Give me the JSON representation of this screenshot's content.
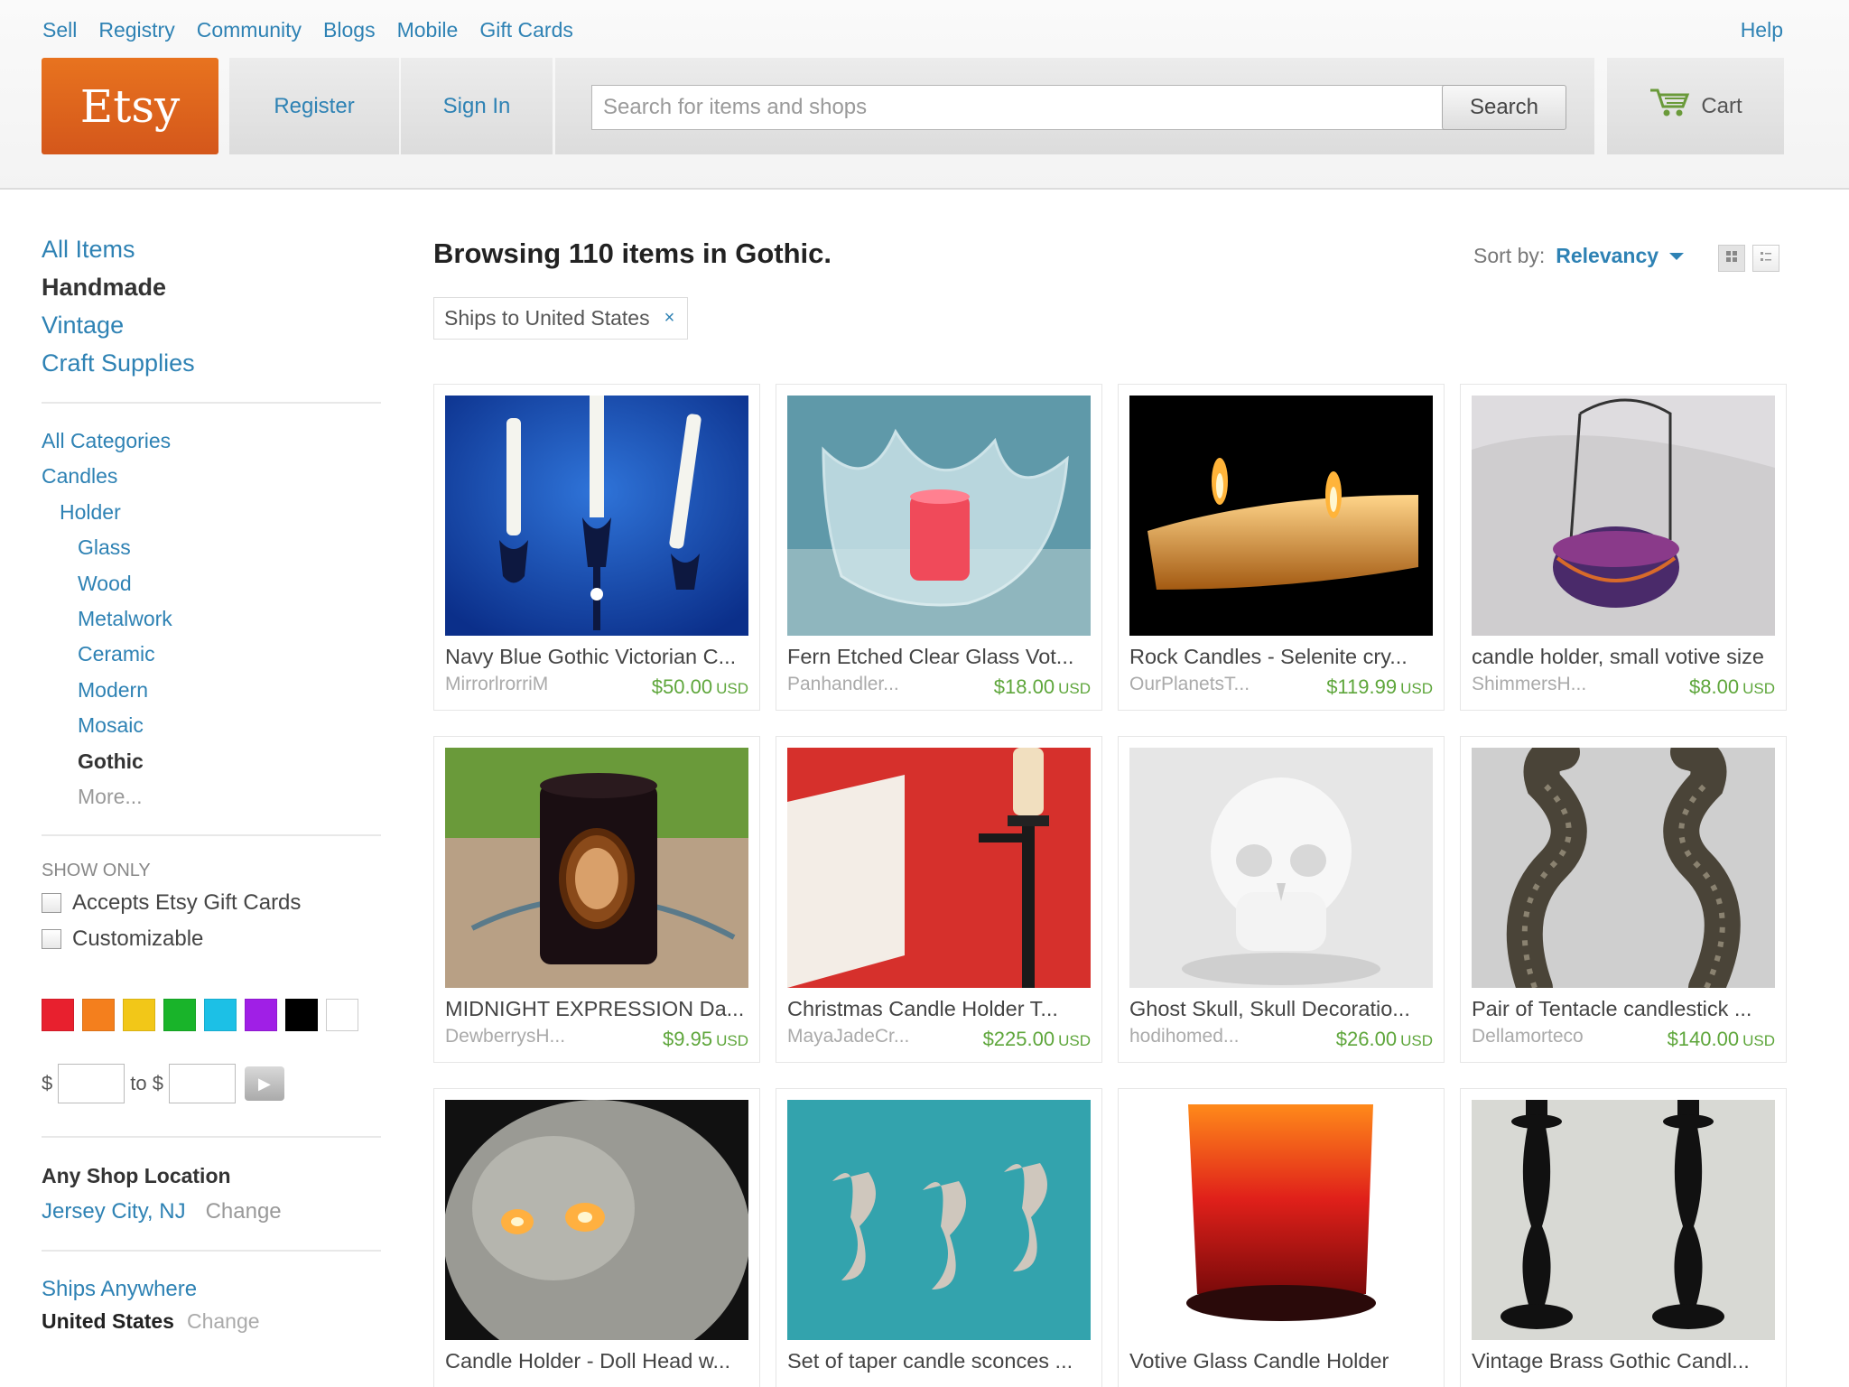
{
  "header": {
    "topnav": [
      "Sell",
      "Registry",
      "Community",
      "Blogs",
      "Mobile",
      "Gift Cards"
    ],
    "help": "Help",
    "logo": "Etsy",
    "register": "Register",
    "signin": "Sign In",
    "search_placeholder": "Search for items and shops",
    "search_button": "Search",
    "cart": "Cart"
  },
  "sidebar": {
    "main_links": [
      {
        "label": "All Items",
        "active": false
      },
      {
        "label": "Handmade",
        "active": true
      },
      {
        "label": "Vintage",
        "active": false
      },
      {
        "label": "Craft Supplies",
        "active": false
      }
    ],
    "categories": [
      {
        "label": "All Categories",
        "level": 0
      },
      {
        "label": "Candles",
        "level": 0
      },
      {
        "label": "Holder",
        "level": 1
      },
      {
        "label": "Glass",
        "level": 2
      },
      {
        "label": "Wood",
        "level": 2
      },
      {
        "label": "Metalwork",
        "level": 2
      },
      {
        "label": "Ceramic",
        "level": 2
      },
      {
        "label": "Modern",
        "level": 2
      },
      {
        "label": "Mosaic",
        "level": 2
      },
      {
        "label": "Gothic",
        "level": 2,
        "active": true
      },
      {
        "label": "More...",
        "level": 2,
        "more": true
      }
    ],
    "show_only_title": "SHOW ONLY",
    "checkboxes": [
      "Accepts Etsy Gift Cards",
      "Customizable"
    ],
    "swatches": [
      "#e8202e",
      "#f47f1d",
      "#f2c718",
      "#19b42a",
      "#1cc0e6",
      "#a01fe6",
      "#000000",
      "#ffffff"
    ],
    "price": {
      "dollar": "$",
      "to": "to $"
    },
    "location_title": "Any Shop Location",
    "location_city": "Jersey City, NJ",
    "change": "Change",
    "ships_anywhere": "Ships Anywhere",
    "ships_country": "United States"
  },
  "main": {
    "browse_title": "Browsing 110 items in Gothic.",
    "sort_label": "Sort by:",
    "sort_value": "Relevancy",
    "filter_chip": "Ships to United States",
    "filter_remove": "×",
    "currency": "USD",
    "items": [
      {
        "title": "Navy Blue Gothic Victorian C...",
        "shop": "MirrorlrorriM",
        "price": "$50.00",
        "image": "blue-candles"
      },
      {
        "title": "Fern Etched Clear Glass Vot...",
        "shop": "Panhandler...",
        "price": "$18.00",
        "image": "glass-votive"
      },
      {
        "title": "Rock Candles - Selenite cry...",
        "shop": "OurPlanetsT...",
        "price": "$119.99",
        "image": "rock-candle"
      },
      {
        "title": "candle holder, small votive size",
        "shop": "ShimmersH...",
        "price": "$8.00",
        "image": "basket-holder"
      },
      {
        "title": "MIDNIGHT EXPRESSION Da...",
        "shop": "DewberrysH...",
        "price": "$9.95",
        "image": "midnight-votive"
      },
      {
        "title": "Christmas Candle Holder T...",
        "shop": "MayaJadeCr...",
        "price": "$225.00",
        "image": "wall-sconce"
      },
      {
        "title": "Ghost Skull, Skull Decoratio...",
        "shop": "hodihomed...",
        "price": "$26.00",
        "image": "white-skull"
      },
      {
        "title": "Pair of Tentacle candlestick ...",
        "shop": "Dellamorteco",
        "price": "$140.00",
        "image": "tentacles"
      },
      {
        "title": "Candle Holder - Doll Head w...",
        "shop": "",
        "price": "",
        "image": "doll-head"
      },
      {
        "title": "Set of taper candle sconces ...",
        "shop": "",
        "price": "",
        "image": "sconces-teal"
      },
      {
        "title": "Votive Glass Candle Holder",
        "shop": "",
        "price": "",
        "image": "red-votive"
      },
      {
        "title": "Vintage Brass Gothic Candl...",
        "shop": "",
        "price": "",
        "image": "brass-candlesticks"
      }
    ]
  }
}
